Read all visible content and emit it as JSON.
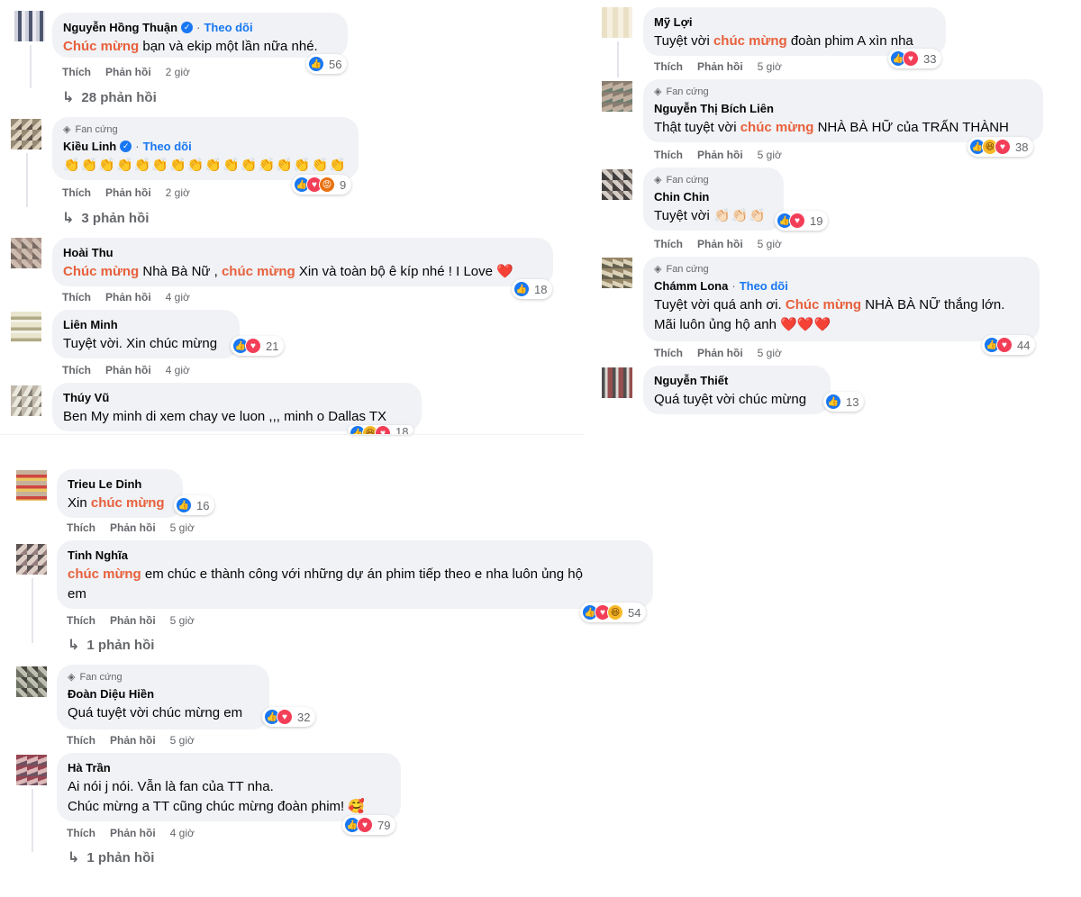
{
  "labels": {
    "like": "Thích",
    "reply": "Phản hồi"
  },
  "colors": {
    "highlight": "#e8603c",
    "link": "#1877f2",
    "bubble": "#f0f2f5"
  },
  "comments": {
    "c1": {
      "name": "Nguyễn Hồng Thuận",
      "follow": "Theo dõi",
      "hl1": "Chúc mừng",
      "text1": " bạn và ekip một lần nữa nhé.",
      "count": "56",
      "time": "2 giờ",
      "replies": "28 phản hồi"
    },
    "c2": {
      "badge": "Fan cứng",
      "name": "Kiều Linh",
      "follow": "Theo dõi",
      "emojis": "👏👏👏👏👏👏👏👏👏👏👏👏👏👏👏👏",
      "count": "9",
      "time": "2 giờ",
      "replies": "3 phản hồi"
    },
    "c3": {
      "name": "Hoài Thu",
      "hl1": "Chúc mừng",
      "text1": " Nhà Bà Nữ , ",
      "hl2": "chúc mừng",
      "text2": " Xin và toàn bộ ê kíp nhé ! I Love ",
      "heart": "❤️",
      "count": "18",
      "time": "4 giờ"
    },
    "c4": {
      "name": "Liên Minh",
      "text1": "Tuyệt vời. Xin chúc mừng",
      "count": "21",
      "time": "4 giờ"
    },
    "c5": {
      "name": "Thúy Vũ",
      "text1": "Ben My minh di xem chay ve luon ,,, minh o Dallas TX",
      "count": "18"
    },
    "c6": {
      "name": "Mỹ Lợi",
      "text1": "Tuyệt vời ",
      "hl1": "chúc mừng",
      "text2": " đoàn phim A xìn nha",
      "count": "33",
      "time": "5 giờ"
    },
    "c7": {
      "badge": "Fan cứng",
      "name": "Nguyễn Thị Bích Liên",
      "text1": "Thật tuyệt vời ",
      "hl1": "chúc mừng",
      "text2": " NHÀ BÀ HỮ của TRẤN THÀNH",
      "count": "38",
      "time": "5 giờ"
    },
    "c8": {
      "badge": "Fan cứng",
      "name": "Chin Chin",
      "text1": "Tuyệt vời ",
      "emojis": "👏🏻👏🏻👏🏻",
      "count": "19",
      "time": "5 giờ"
    },
    "c9": {
      "badge": "Fan cứng",
      "name": "Chámm Lona",
      "follow": "Theo dõi",
      "text1": "Tuyệt vời quá anh ơi. ",
      "hl1": "Chúc mừng",
      "text2": " NHÀ BÀ NỮ thắng lớn.",
      "line2": "Mãi luôn ủng hộ anh ",
      "hearts": "❤️❤️❤️",
      "count": "44",
      "time": "5 giờ"
    },
    "c10": {
      "name": "Nguyễn Thiết",
      "text1": "Quá tuyệt vời chúc mừng",
      "count": "13"
    },
    "c11": {
      "name": "Trieu Le Dinh",
      "text1": "Xin ",
      "hl1": "chúc mừng",
      "count": "16",
      "time": "5 giờ"
    },
    "c12": {
      "name": "Tinh Nghĩa",
      "hl1": "chúc mừng",
      "text1": " em chúc e thành công với những dự án phim tiếp theo e nha luôn ủng hộ",
      "line2": "em",
      "count": "54",
      "time": "5 giờ",
      "replies": "1 phản hồi"
    },
    "c13": {
      "badge": "Fan cứng",
      "name": "Đoàn Diệu Hiền",
      "text1": "Quá tuyệt vời chúc mừng em",
      "count": "32",
      "time": "5 giờ"
    },
    "c14": {
      "name": "Hà Trần",
      "text1": "Ai nói j nói. Vẫn là fan của TT nha.",
      "line2": "Chúc mừng a TT cũng chúc mừng đoàn phim! ",
      "emoji": "🥰",
      "count": "79",
      "time": "4 giờ",
      "replies": "1 phản hồi"
    }
  }
}
